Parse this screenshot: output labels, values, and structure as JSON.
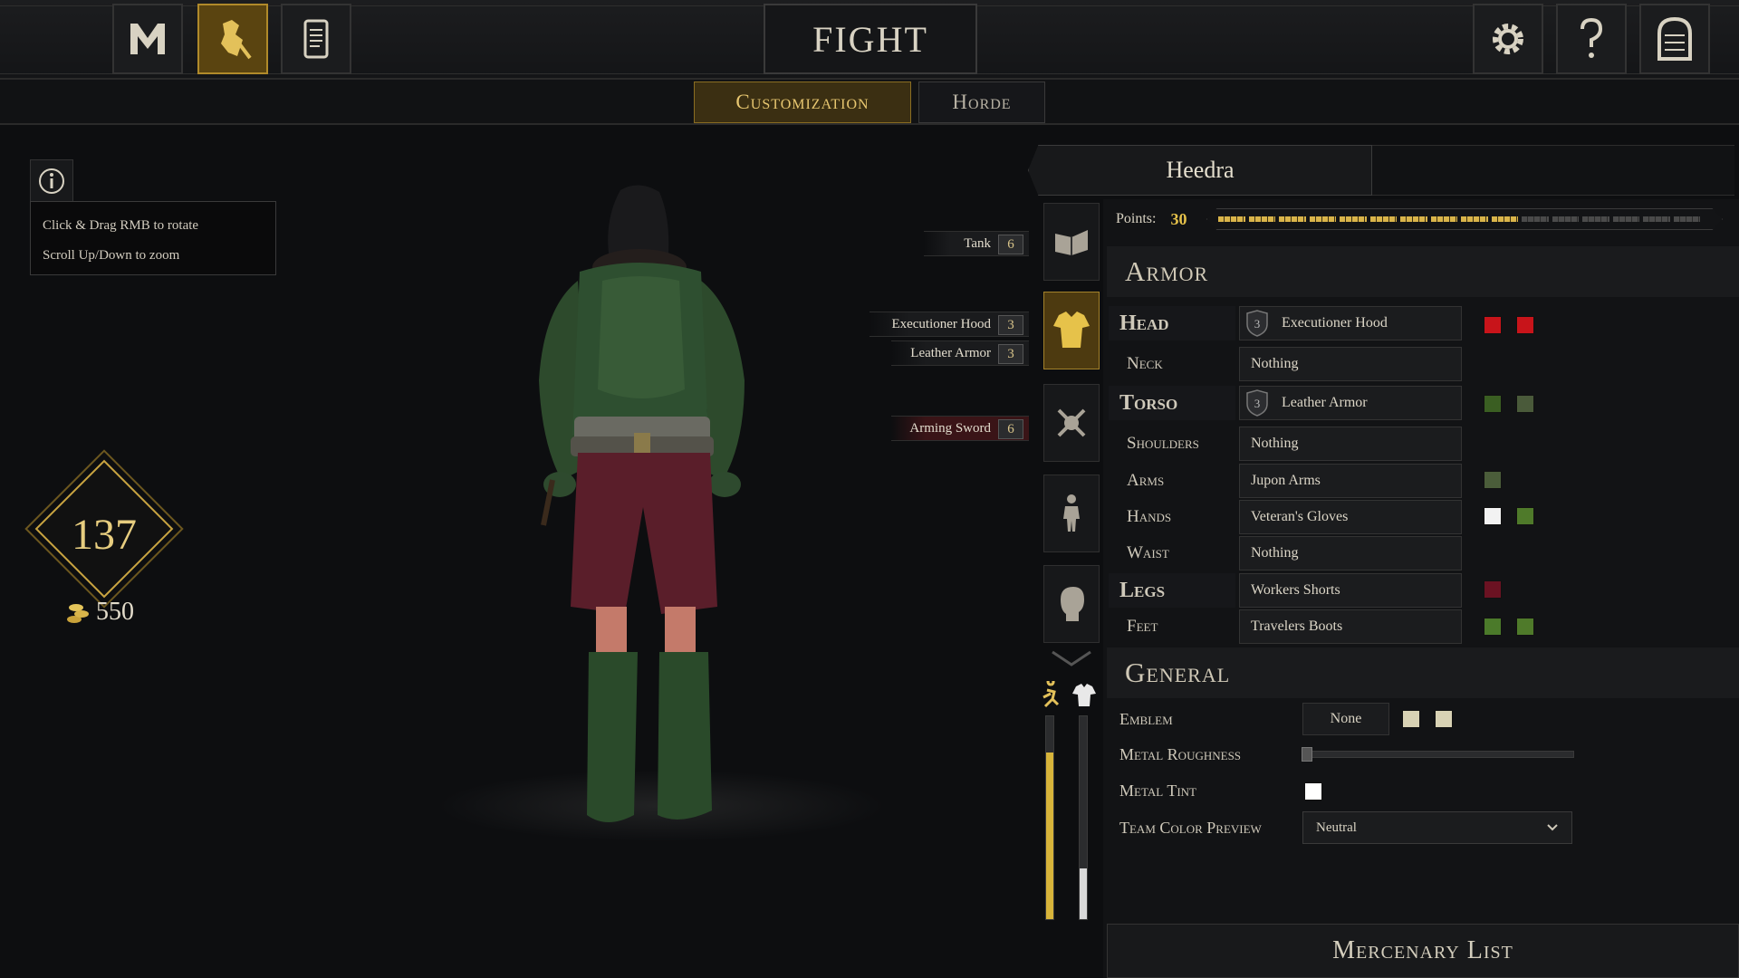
{
  "top_nav": {
    "title": "FIGHT",
    "left_icons": [
      "mordhau-logo-icon",
      "customize-icon",
      "scroll-icon"
    ],
    "right_icons": [
      "gear-icon",
      "help-icon",
      "exit-door-icon"
    ]
  },
  "sub_tabs": [
    {
      "label": "Customization",
      "active": true
    },
    {
      "label": "Horde",
      "active": false
    }
  ],
  "controls_hint": {
    "line1": "Click & Drag RMB to rotate",
    "line2": "Scroll Up/Down to zoom"
  },
  "player": {
    "level": "137",
    "gold": "550"
  },
  "loadout_tags": [
    {
      "label": "Tank",
      "points": "6",
      "type": "perk"
    },
    {
      "label": "Executioner Hood",
      "points": "3",
      "type": "armor"
    },
    {
      "label": "Leather Armor",
      "points": "3",
      "type": "armor"
    },
    {
      "label": "Arming Sword",
      "points": "6",
      "type": "weapon"
    }
  ],
  "category_icons": [
    "book-icon",
    "armor-icon",
    "crossed-swords-icon",
    "body-icon",
    "head-icon"
  ],
  "gauges": {
    "speed": {
      "icon": "running-icon",
      "fraction": 0.82,
      "color": "#d7b43a"
    },
    "armor": {
      "icon": "armor-stat-icon",
      "fraction": 0.25,
      "color": "#d9d9d9"
    }
  },
  "character": {
    "name": "Heedra",
    "points_label": "Points:",
    "points": "30",
    "points_filled": 10,
    "points_total": 16
  },
  "armor": {
    "heading": "Armor",
    "slots": [
      {
        "label": "Head",
        "major": true,
        "value": "Executioner Hood",
        "tier": "3",
        "colors": [
          "#c8141a",
          "#c8141a"
        ]
      },
      {
        "label": "Neck",
        "major": false,
        "value": "Nothing",
        "tier": "",
        "colors": []
      },
      {
        "label": "Torso",
        "major": true,
        "value": "Leather Armor",
        "tier": "3",
        "colors": [
          "#3a5e22",
          "#4a5a3a"
        ]
      },
      {
        "label": "Shoulders",
        "major": false,
        "value": "Nothing",
        "tier": "",
        "colors": []
      },
      {
        "label": "Arms",
        "major": false,
        "value": "Jupon Arms",
        "tier": "",
        "colors": [
          "#4b5d3a"
        ]
      },
      {
        "label": "Hands",
        "major": false,
        "value": "Veteran's Gloves",
        "tier": "",
        "colors": [
          "#f2f2f2",
          "#4f7a2a"
        ]
      },
      {
        "label": "Waist",
        "major": false,
        "value": "Nothing",
        "tier": "",
        "colors": []
      },
      {
        "label": "Legs",
        "major": true,
        "value": "Workers Shorts",
        "tier": "",
        "colors": [
          "#6b1222"
        ]
      },
      {
        "label": "Feet",
        "major": false,
        "value": "Travelers Boots",
        "tier": "",
        "colors": [
          "#4b7a2a",
          "#4f7a2a"
        ]
      }
    ]
  },
  "general": {
    "heading": "General",
    "emblem_label": "Emblem",
    "emblem_value": "None",
    "emblem_colors": [
      "#d8d2b4",
      "#d8d2b4"
    ],
    "metal_roughness_label": "Metal Roughness",
    "metal_roughness_value": 0,
    "metal_tint_label": "Metal Tint",
    "metal_tint_color": "#ffffff",
    "team_color_label": "Team Color Preview",
    "team_color_value": "Neutral"
  },
  "mercenary_button": "Mercenary List"
}
